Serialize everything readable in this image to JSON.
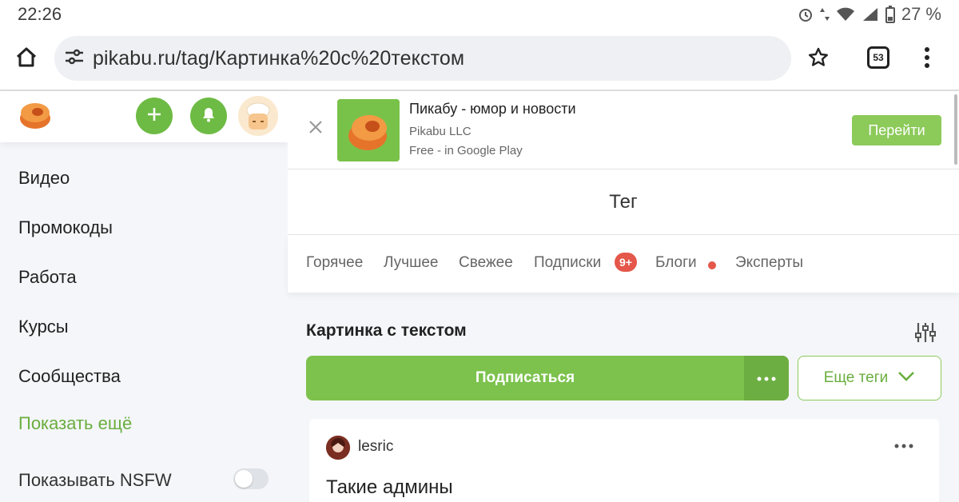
{
  "status_bar": {
    "time": "22:26",
    "battery": "27 %"
  },
  "browser": {
    "url": "pikabu.ru/tag/Картинка%20с%20текстом",
    "tab_count": "53"
  },
  "sidebar": {
    "items": [
      "Видео",
      "Промокоды",
      "Работа",
      "Курсы",
      "Сообщества"
    ],
    "show_more": "Показать ещё",
    "nsfw_label": "Показывать NSFW",
    "nsfw_enabled": false
  },
  "banner": {
    "app_title": "Пикабу - юмор и новости",
    "publisher": "Pikabu LLC",
    "store": "Free - in Google Play",
    "button": "Перейти"
  },
  "page": {
    "title": "Тег"
  },
  "tabs": [
    {
      "label": "Горячее"
    },
    {
      "label": "Лучшее"
    },
    {
      "label": "Свежее"
    },
    {
      "label": "Подписки",
      "badge": "9+"
    },
    {
      "label": "Блоги",
      "dot": true
    },
    {
      "label": "Эксперты"
    }
  ],
  "tag": {
    "name": "Картинка с текстом",
    "subscribe": "Подписаться",
    "more_tags": "Еще теги"
  },
  "post": {
    "author": "lesric",
    "title": "Такие админы"
  },
  "colors": {
    "accent": "#7cc24d",
    "badge": "#e4574a",
    "link": "#6aae3f"
  }
}
